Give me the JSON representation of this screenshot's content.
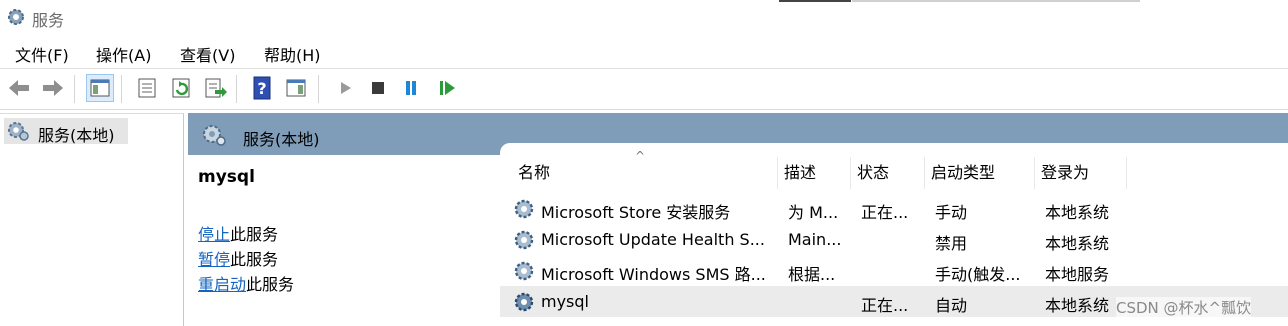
{
  "window": {
    "title": "服务",
    "icon": "gear-icon"
  },
  "menu": [
    "文件(F)",
    "操作(A)",
    "查看(V)",
    "帮助(H)"
  ],
  "toolbar": {
    "icons": [
      "back-arrow-icon",
      "forward-arrow-icon",
      "show-hide-console-tree-icon",
      "properties-icon",
      "refresh-icon",
      "export-list-icon",
      "help-icon",
      "action-pane-icon",
      "start-service-icon",
      "stop-service-icon",
      "pause-service-icon",
      "resume-service-icon"
    ]
  },
  "tree": {
    "root_label": "服务(本地)"
  },
  "main": {
    "header": "服务(本地)",
    "selected_service": "mysql",
    "actions": [
      {
        "link": "停止",
        "rest": "此服务"
      },
      {
        "link": "暂停",
        "rest": "此服务"
      },
      {
        "link": "重启动",
        "rest": "此服务"
      }
    ]
  },
  "list": {
    "columns": [
      "名称",
      "描述",
      "状态",
      "启动类型",
      "登录为"
    ],
    "rows": [
      {
        "name": "Microsoft Store 安装服务",
        "desc": "为 M...",
        "status": "正在...",
        "startup": "手动",
        "logon": "本地系统"
      },
      {
        "name": "Microsoft Update Health S...",
        "desc": "Main...",
        "status": "",
        "startup": "禁用",
        "logon": "本地系统"
      },
      {
        "name": "Microsoft Windows SMS 路...",
        "desc": "根据...",
        "status": "",
        "startup": "手动(触发...",
        "logon": "本地服务"
      },
      {
        "name": "mysql",
        "desc": "",
        "status": "正在...",
        "startup": "自动",
        "logon": "本地系统"
      }
    ]
  },
  "watermark": "CSDN @杯水^瓢饮",
  "colors": {
    "header_bg": "#7f9db8",
    "link": "#1565c0",
    "selected_row": "#ebebeb"
  }
}
